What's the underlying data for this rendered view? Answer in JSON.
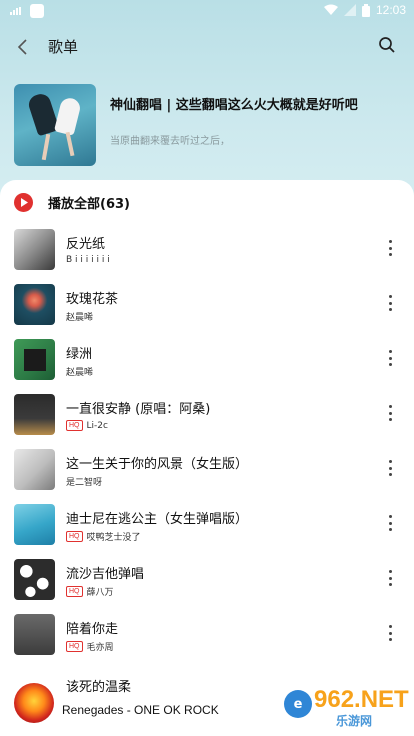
{
  "status_bar": {
    "time": "12:03"
  },
  "header": {
    "title": "歌单"
  },
  "playlist": {
    "title": "神仙翻唱 | 这些翻唱这么火大概就是好听吧",
    "description": "当原曲翻来覆去听过之后，"
  },
  "play_all": {
    "label": "播放全部(63)"
  },
  "songs": [
    {
      "title": "反光纸",
      "artist": "B i i i i i i i",
      "hq": false
    },
    {
      "title": "玫瑰花茶",
      "artist": "赵晨唏",
      "hq": false
    },
    {
      "title": "绿洲",
      "artist": "赵晨唏",
      "hq": false
    },
    {
      "title": "一直很安静 (原唱：阿桑)",
      "artist": "Li-2c",
      "hq": true
    },
    {
      "title": "这一生关于你的风景（女生版）",
      "artist": "是二智呀",
      "hq": false
    },
    {
      "title": "迪士尼在逃公主（女生弹唱版）",
      "artist": "哎鸭芝士没了",
      "hq": true
    },
    {
      "title": "流沙吉他弹唱",
      "artist": "薛八万",
      "hq": true
    },
    {
      "title": "陪着你走",
      "artist": "毛亦周",
      "hq": true
    }
  ],
  "hq_label": "HQ",
  "partial_song": {
    "title": "该死的温柔"
  },
  "mini_player": {
    "title": "Renegades - ONE OK ROCK"
  },
  "watermark": {
    "text": "962.NET",
    "sub": "乐游网"
  }
}
